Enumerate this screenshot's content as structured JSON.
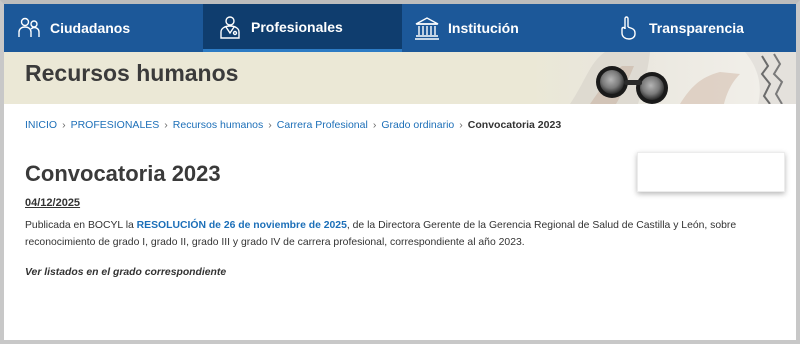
{
  "nav": {
    "items": [
      {
        "label": "Ciudadanos",
        "icon": "people-icon"
      },
      {
        "label": "Profesionales",
        "icon": "doctor-icon",
        "active": true
      },
      {
        "label": "Institución",
        "icon": "building-icon"
      },
      {
        "label": "Transparencia",
        "icon": "hand-icon"
      }
    ]
  },
  "banner": {
    "title": "Recursos humanos"
  },
  "breadcrumb": {
    "items": [
      "INICIO",
      "PROFESIONALES",
      "Recursos humanos",
      "Carrera Profesional",
      "Grado ordinario"
    ],
    "separator": "›",
    "current": "Convocatoria 2023"
  },
  "article": {
    "title": "Convocatoria 2023",
    "date": "04/12/2025",
    "para_before": "Publicada en BOCYL la ",
    "link": "RESOLUCIÓN de 26 de noviembre de 2025",
    "para_after": ", de la Directora Gerente de la Gerencia Regional de Salud de Castilla y León, sobre reconocimiento de grado I, grado II, grado III y grado IV de carrera profesional, correspondiente al año 2023.",
    "note": "Ver listados en el grado correspondiente"
  },
  "colors": {
    "nav_bg": "#1c5899",
    "nav_active": "#0f3d6e",
    "banner_bg": "#ebe8d6",
    "link": "#1c6fb8"
  }
}
